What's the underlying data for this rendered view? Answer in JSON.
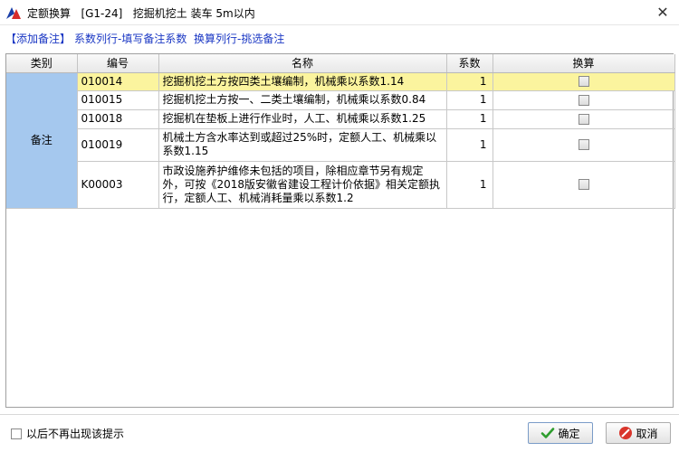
{
  "window": {
    "title": "定额换算   [G1-24]   挖掘机挖土 装车 5m以内"
  },
  "hint": {
    "add_note": "【添加备注】",
    "coef_col": "系数列行-填写备注系数",
    "convert_col": "换算列行-挑选备注"
  },
  "table": {
    "columns": [
      "类别",
      "编号",
      "名称",
      "系数",
      "换算"
    ],
    "category": "备注",
    "rows": [
      {
        "code": "010014",
        "name": "挖掘机挖土方按四类土壤编制，机械乘以系数1.14",
        "coef": "1",
        "checked": false
      },
      {
        "code": "010015",
        "name": "挖掘机挖土方按一、二类土壤编制，机械乘以系数0.84",
        "coef": "1",
        "checked": false
      },
      {
        "code": "010018",
        "name": "挖掘机在垫板上进行作业时，人工、机械乘以系数1.25",
        "coef": "1",
        "checked": false
      },
      {
        "code": "010019",
        "name": "机械土方含水率达到或超过25%时，定额人工、机械乘以系数1.15",
        "coef": "1",
        "checked": false
      },
      {
        "code": "K00003",
        "name": "市政设施养护维修未包括的项目，除相应章节另有规定外，可按《2018版安徽省建设工程计价依据》相关定额执行，定额人工、机械消耗量乘以系数1.2",
        "coef": "1",
        "checked": false
      }
    ]
  },
  "footer": {
    "dont_show": "以后不再出现该提示",
    "ok": "确定",
    "cancel": "取消"
  }
}
